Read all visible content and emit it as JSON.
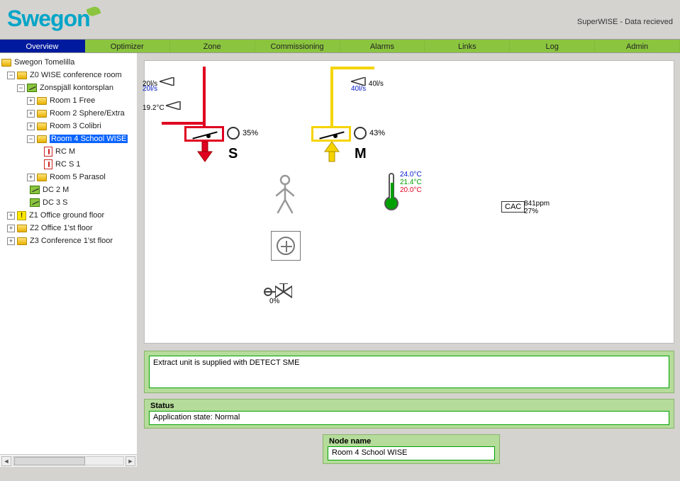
{
  "header": {
    "brand": "Swegon",
    "status": "SuperWISE - Data recieved"
  },
  "nav": {
    "items": [
      "Overview",
      "Optimizer",
      "Zone",
      "Commissioning",
      "Alarms",
      "Links",
      "Log",
      "Admin"
    ],
    "active": "Overview"
  },
  "tree": {
    "root": "Swegon Tomelilla",
    "z0": "Z0 WISE conference room",
    "zonspjall": "Zonspjäll kontorsplan",
    "room1": "Room 1 Free",
    "room2": "Room 2 Sphere/Extra",
    "room3": "Room 3 Colibri",
    "room4": "Room 4 School WISE",
    "rcm": "RC M",
    "rcs1": "RC S 1",
    "room5": "Room 5 Parasol",
    "dc2m": "DC 2 M",
    "dc3s": "DC 3 S",
    "z1": "Z1 Office ground floor",
    "z2": "Z2 Office 1'st floor",
    "z3": "Z3 Conference 1'st floor"
  },
  "supply": {
    "flow_actual": "20l/s",
    "flow_setpoint": "20l/s",
    "temp": "19.2°C",
    "damper_pct": "35%",
    "label": "S"
  },
  "extract": {
    "flow_actual": "40l/s",
    "flow_setpoint": "40l/s",
    "damper_pct": "43%",
    "label": "M"
  },
  "thermo": {
    "high": "24.0°C",
    "current": "21.4°C",
    "low": "20.0°C"
  },
  "cac": {
    "label": "CAC",
    "ppm": "841ppm",
    "pct": "27%"
  },
  "valve": {
    "pct": "0%"
  },
  "message": {
    "text": "Extract unit is supplied with DETECT SME"
  },
  "status": {
    "title": "Status",
    "text": "Application state: Normal"
  },
  "node": {
    "title": "Node name",
    "value": "Room 4 School WISE"
  }
}
